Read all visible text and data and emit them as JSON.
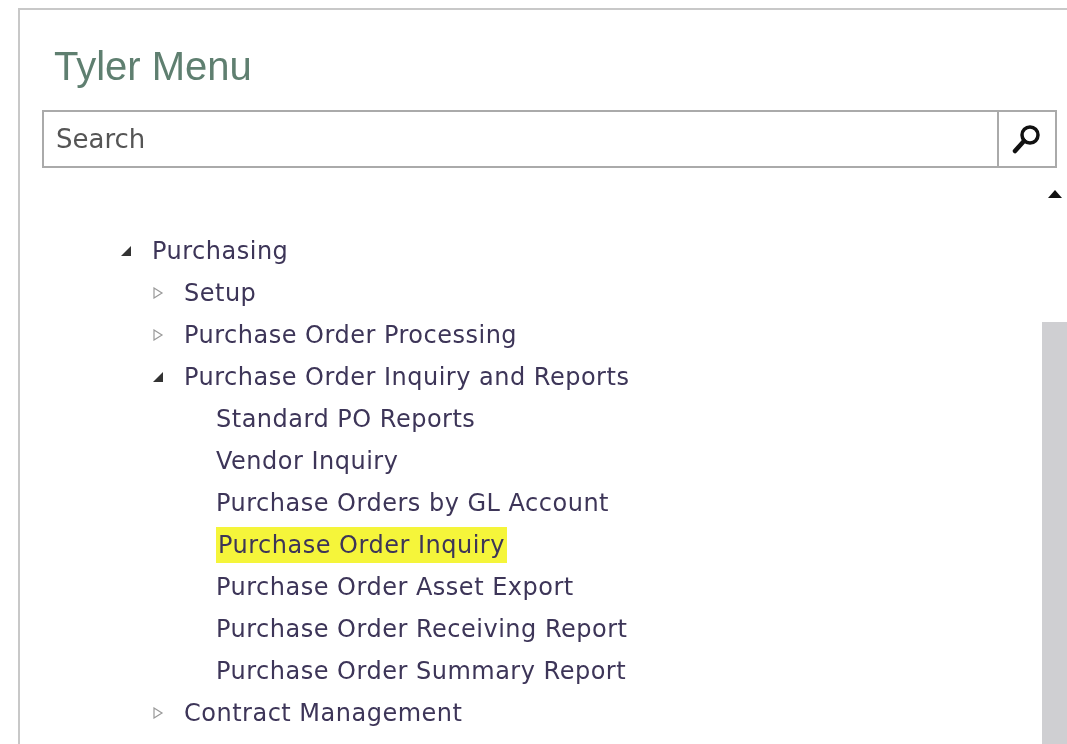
{
  "window": {
    "title": "Tyler Menu"
  },
  "search": {
    "placeholder": "Search"
  },
  "tree": [
    {
      "kind": "branch",
      "label": "Purchasing",
      "expanded": true,
      "children": [
        {
          "kind": "branch",
          "label": "Setup",
          "expanded": false
        },
        {
          "kind": "branch",
          "label": "Purchase Order Processing",
          "expanded": false
        },
        {
          "kind": "branch",
          "label": "Purchase Order Inquiry and Reports",
          "expanded": true,
          "children": [
            {
              "kind": "leaf",
              "label": "Standard PO Reports",
              "selected": false
            },
            {
              "kind": "leaf",
              "label": "Vendor Inquiry",
              "selected": false
            },
            {
              "kind": "leaf",
              "label": "Purchase Orders by GL Account",
              "selected": false
            },
            {
              "kind": "leaf",
              "label": "Purchase Order Inquiry",
              "selected": true
            },
            {
              "kind": "leaf",
              "label": "Purchase Order Asset Export",
              "selected": false
            },
            {
              "kind": "leaf",
              "label": "Purchase Order Receiving Report",
              "selected": false
            },
            {
              "kind": "leaf",
              "label": "Purchase Order Summary Report",
              "selected": false
            }
          ]
        },
        {
          "kind": "branch",
          "label": "Contract Management",
          "expanded": false
        }
      ]
    }
  ]
}
